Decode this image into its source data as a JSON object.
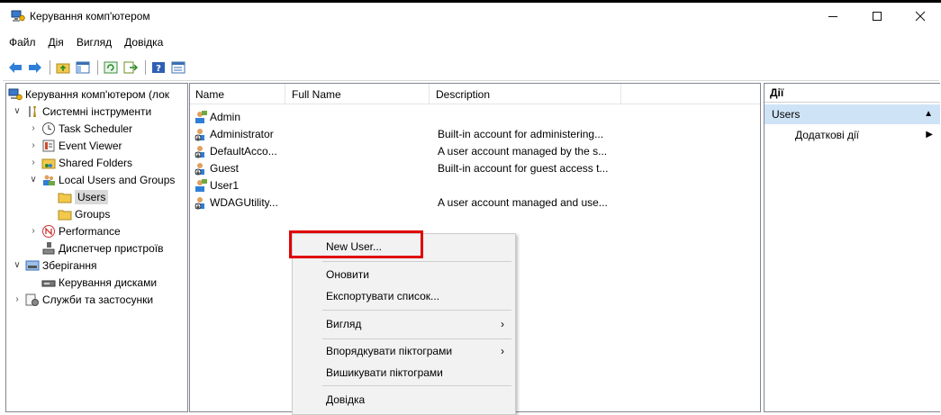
{
  "window": {
    "title": "Керування комп'ютером",
    "controls": [
      "minimize-icon",
      "maximize-icon",
      "close-icon"
    ]
  },
  "menu": [
    "Файл",
    "Дія",
    "Вигляд",
    "Довідка"
  ],
  "toolbar": [
    "back-icon",
    "forward-icon",
    "up-folder-icon",
    "show-hide-tree-icon",
    "refresh-icon",
    "export-list-icon",
    "help-icon",
    "properties-icon"
  ],
  "tree": {
    "root": "Керування комп'ютером (лок",
    "system_tools": "Системні інструменти",
    "task_scheduler": "Task Scheduler",
    "event_viewer": "Event Viewer",
    "shared_folders": "Shared Folders",
    "local_users": "Local Users and Groups",
    "users": "Users",
    "groups": "Groups",
    "performance": "Performance",
    "device_manager": "Диспетчер пристроїв",
    "storage": "Зберігання",
    "disk_management": "Керування дисками",
    "services": "Служби та застосунки"
  },
  "list": {
    "columns": [
      "Name",
      "Full Name",
      "Description"
    ],
    "rows": [
      {
        "name": "Admin",
        "full_name": "",
        "description": ""
      },
      {
        "name": "Administrator",
        "full_name": "",
        "description": "Built-in account for administering..."
      },
      {
        "name": "DefaultAcco...",
        "full_name": "",
        "description": "A user account managed by the s..."
      },
      {
        "name": "Guest",
        "full_name": "",
        "description": "Built-in account for guest access t..."
      },
      {
        "name": "User1",
        "full_name": "",
        "description": ""
      },
      {
        "name": "WDAGUtility...",
        "full_name": "",
        "description": "A user account managed and use..."
      }
    ]
  },
  "actions": {
    "title": "Дії",
    "section": "Users",
    "item": "Додаткові дії"
  },
  "context_menu": {
    "new_user": "New User...",
    "refresh": "Оновити",
    "export": "Експортувати список...",
    "view": "Вигляд",
    "arrange": "Впорядкувати піктограми",
    "line_up": "Вишикувати піктограми",
    "help": "Довідка"
  },
  "colors": {
    "highlight": "#e00000",
    "action_section": "#cfe3f7"
  }
}
